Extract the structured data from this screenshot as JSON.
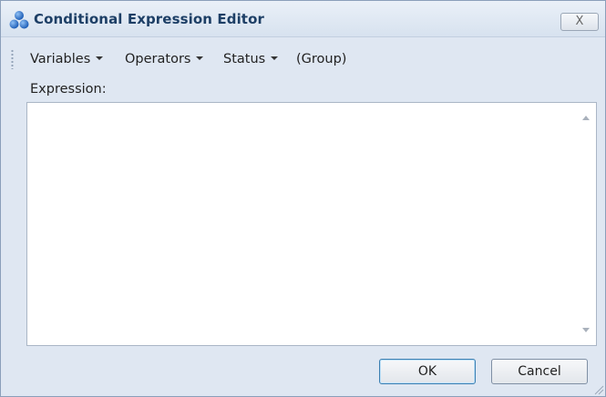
{
  "window": {
    "title": "Conditional Expression Editor",
    "close_label": "X",
    "app_icon": "three-spheres-icon"
  },
  "menubar": {
    "items": [
      {
        "label": "Variables",
        "has_dropdown": true
      },
      {
        "label": "Operators",
        "has_dropdown": true
      },
      {
        "label": "Status",
        "has_dropdown": true
      },
      {
        "label": "(Group)",
        "has_dropdown": false
      }
    ]
  },
  "expression": {
    "label": "Expression:",
    "value": ""
  },
  "buttons": {
    "ok_label": "OK",
    "cancel_label": "Cancel"
  },
  "colors": {
    "title_text": "#1d3f66",
    "window_bg": "#dfe7f2",
    "icon_blue": "#2f6fc4"
  }
}
